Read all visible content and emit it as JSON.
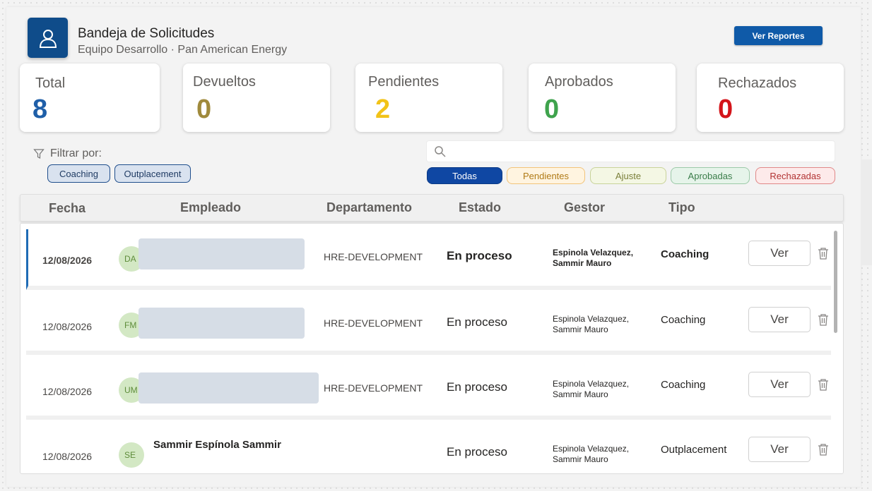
{
  "header": {
    "title": "Bandeja de Solicitudes",
    "subtitle": "Equipo Desarrollo · Pan American Energy",
    "reports_button": "Ver Reportes",
    "icon": "user-icon"
  },
  "stats": [
    {
      "label": "Total",
      "value": "8",
      "color": "#1f5fa8"
    },
    {
      "label": "Devueltos",
      "value": "0",
      "color": "#a08a3c"
    },
    {
      "label": "Pendientes",
      "value": "2",
      "color": "#f2c318"
    },
    {
      "label": "Aprobados",
      "value": "0",
      "color": "#3fa34d"
    },
    {
      "label": "Rechazados",
      "value": "0",
      "color": "#d4141a"
    }
  ],
  "filters": {
    "label": "Filtrar por:",
    "chips": [
      "Coaching",
      "Outplacement"
    ]
  },
  "search": {
    "placeholder": ""
  },
  "status_filters": [
    {
      "label": "Todas",
      "active": true
    },
    {
      "label": "Pendientes"
    },
    {
      "label": "Ajuste"
    },
    {
      "label": "Aprobadas"
    },
    {
      "label": "Rechazadas"
    }
  ],
  "table": {
    "columns": [
      "Fecha",
      "Empleado",
      "Departamento",
      "Estado",
      "Gestor",
      "Tipo"
    ],
    "rows": [
      {
        "fecha": "12/08/2026",
        "initials": "DA",
        "empleado": "",
        "departamento": "HRE-DEVELOPMENT",
        "estado": "En proceso",
        "gestor_line1": "Espinola Velazquez,",
        "gestor_line2": "Sammir Mauro",
        "tipo": "Coaching",
        "action": "Ver"
      },
      {
        "fecha": "12/08/2026",
        "initials": "FM",
        "empleado": "",
        "departamento": "HRE-DEVELOPMENT",
        "estado": "En proceso",
        "gestor_line1": "Espinola Velazquez,",
        "gestor_line2": "Sammir Mauro",
        "tipo": "Coaching",
        "action": "Ver"
      },
      {
        "fecha": "12/08/2026",
        "initials": "UM",
        "empleado": "",
        "departamento": "HRE-DEVELOPMENT",
        "estado": "En proceso",
        "gestor_line1": "Espinola Velazquez,",
        "gestor_line2": "Sammir Mauro",
        "tipo": "Coaching",
        "action": "Ver"
      },
      {
        "fecha": "12/08/2026",
        "initials": "SE",
        "empleado": "Sammir Espínola Sammir",
        "departamento": "",
        "estado": "En proceso",
        "gestor_line1": "Espinola Velazquez,",
        "gestor_line2": "Sammir Mauro",
        "tipo": "Outplacement",
        "action": "Ver"
      }
    ]
  }
}
